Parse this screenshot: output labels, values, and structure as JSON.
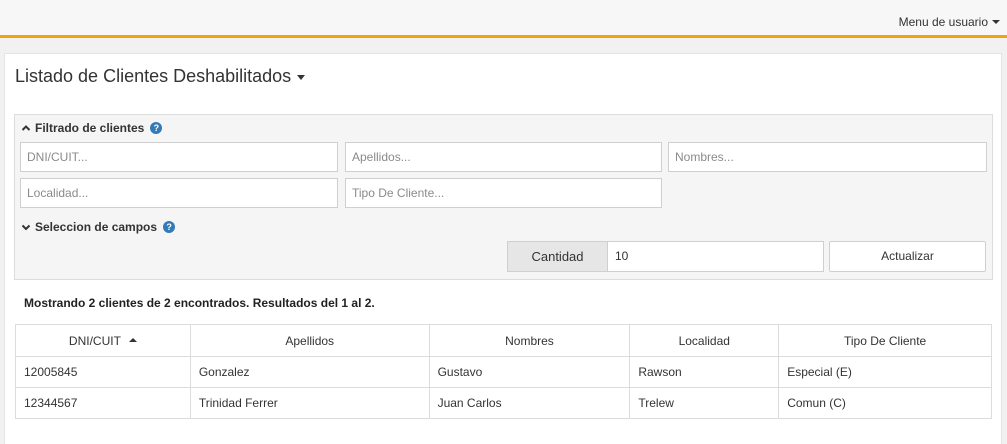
{
  "header": {
    "user_menu_label": "Menu de usuario"
  },
  "page": {
    "title": "Listado de Clientes Deshabilitados"
  },
  "filter": {
    "title": "Filtrado de clientes",
    "fields": {
      "dni": "DNI/CUIT...",
      "apellidos": "Apellidos...",
      "nombres": "Nombres...",
      "localidad": "Localidad...",
      "tipo": "Tipo De Cliente..."
    }
  },
  "fields_section": {
    "title": "Seleccion de campos",
    "quantity_label": "Cantidad",
    "quantity_value": "10",
    "update_label": "Actualizar"
  },
  "results": {
    "summary": "Mostrando 2 clientes de 2 encontrados. Resultados del 1 al 2."
  },
  "table": {
    "headers": [
      "DNI/CUIT",
      "Apellidos",
      "Nombres",
      "Localidad",
      "Tipo De Cliente"
    ],
    "rows": [
      [
        "12005845",
        "Gonzalez",
        "Gustavo",
        "Rawson",
        "Especial (E)"
      ],
      [
        "12344567",
        "Trinidad Ferrer",
        "Juan Carlos",
        "Trelew",
        "Comun (C)"
      ]
    ]
  },
  "colors": {
    "accent": "#f0a30a",
    "help_icon": "#337ab7"
  }
}
